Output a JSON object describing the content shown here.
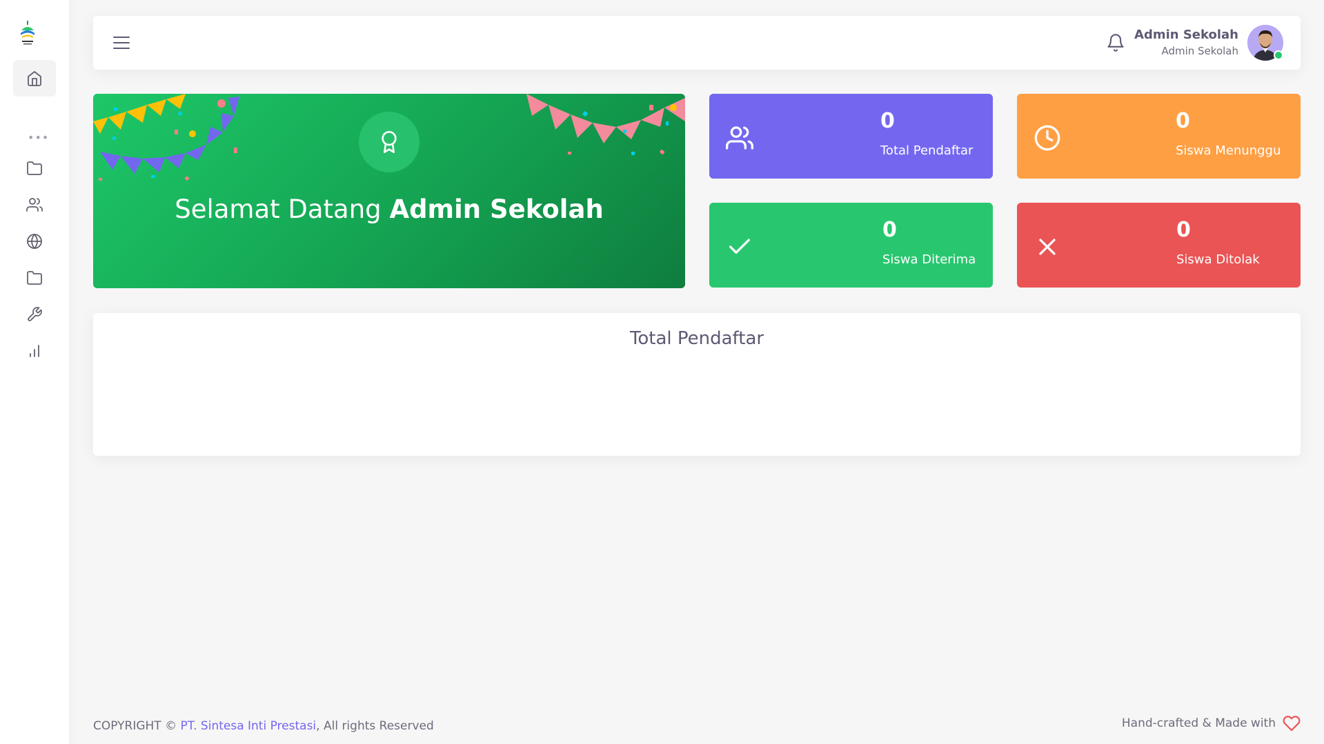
{
  "sidebar": {
    "logo_icon": "school-logo",
    "items": [
      {
        "icon": "home-icon",
        "active": true
      },
      {
        "icon": "more-horizontal-icon"
      },
      {
        "icon": "folder-icon"
      },
      {
        "icon": "users-icon"
      },
      {
        "icon": "globe-icon"
      },
      {
        "icon": "folder-icon"
      },
      {
        "icon": "tool-icon"
      },
      {
        "icon": "bar-chart-icon"
      }
    ]
  },
  "header": {
    "menu_icon": "menu-icon",
    "notification_icon": "bell-icon",
    "user": {
      "name": "Admin Sekolah",
      "role": "Admin Sekolah",
      "status_color": "#28c76f"
    }
  },
  "welcome": {
    "greeting": "Selamat Datang",
    "name": "Admin Sekolah",
    "icon": "award-icon",
    "color": "#1ec768"
  },
  "stats": [
    {
      "value": "0",
      "label": "Total Pendaftar",
      "icon": "users-icon",
      "color": "#7367f0"
    },
    {
      "value": "0",
      "label": "Siswa Menunggu",
      "icon": "clock-icon",
      "color": "#ff9f43"
    },
    {
      "value": "0",
      "label": "Siswa Diterima",
      "icon": "check-icon",
      "color": "#28c76f"
    },
    {
      "value": "0",
      "label": "Siswa Ditolak",
      "icon": "x-icon",
      "color": "#ea5455"
    }
  ],
  "chart": {
    "title": "Total Pendaftar"
  },
  "footer": {
    "copyright_prefix": "COPYRIGHT ©",
    "company": "PT. Sintesa Inti Prestasi",
    "rights": ", All rights Reserved",
    "made_with": "Hand-crafted & Made with",
    "heart_icon": "heart-icon"
  }
}
